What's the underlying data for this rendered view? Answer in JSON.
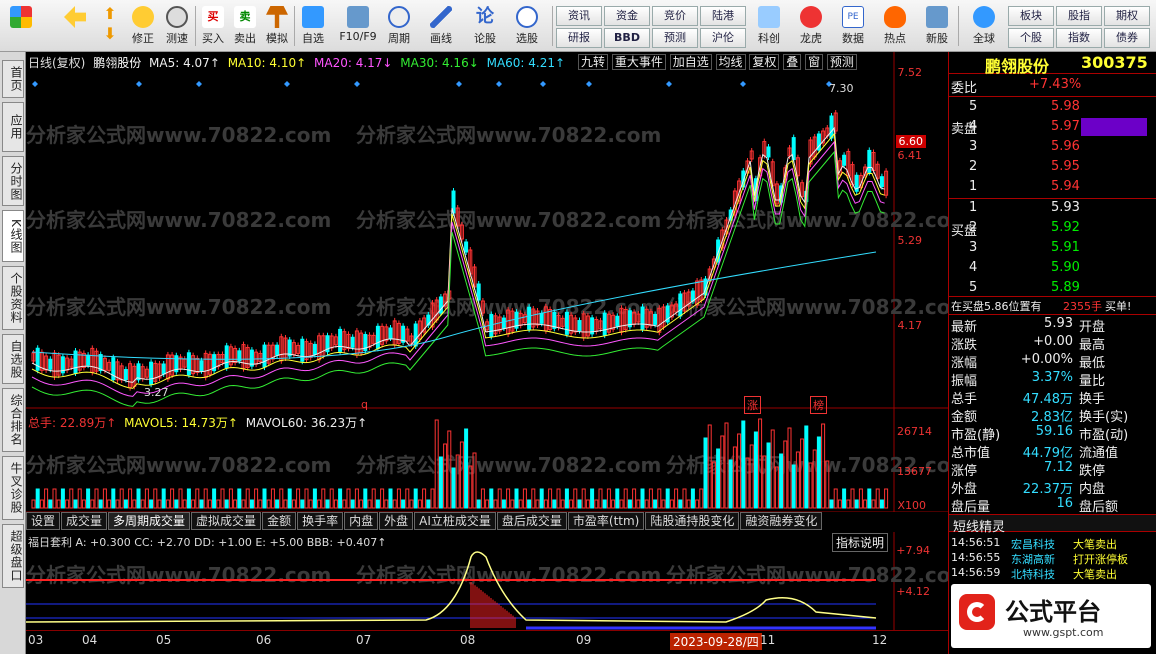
{
  "toolbar": {
    "buttons": [
      "买入",
      "卖出",
      "模拟",
      "自选",
      "F10/F9",
      "周期",
      "画线",
      "论股",
      "选股",
      "科创",
      "龙虎",
      "数据",
      "热点",
      "新股",
      "全球"
    ],
    "nav": [
      "修正",
      "测速"
    ],
    "links": [
      "资讯",
      "资金",
      "竞价",
      "陆港",
      "研报",
      "BBD",
      "预测",
      "沪伦"
    ],
    "right_links": [
      "板块",
      "股指",
      "期权",
      "个股",
      "指数",
      "债券"
    ]
  },
  "left_tabs": [
    "首页",
    "应用",
    "分时图",
    "K线图",
    "个股资料",
    "自选股",
    "综合排名",
    "牛叉诊股",
    "超级盘口"
  ],
  "chart": {
    "header_prefix": "日线(复权)",
    "stock": "鹏翎股份",
    "ma": [
      {
        "label": "MA5: 4.07↑",
        "color": "#eeeeee"
      },
      {
        "label": "MA10: 4.10↑",
        "color": "#ffff33"
      },
      {
        "label": "MA20: 4.17↓",
        "color": "#ff55ff"
      },
      {
        "label": "MA30: 4.16↓",
        "color": "#33ee33"
      },
      {
        "label": "MA60: 4.21↑",
        "color": "#33ddff"
      }
    ],
    "top_buttons": [
      "九转",
      "重大事件",
      "加自选",
      "均线",
      "复权",
      "叠",
      "窗",
      "预测"
    ],
    "price_labels": [
      "7.52",
      "6.60",
      "6.41",
      "5.29",
      "4.17"
    ],
    "high_label": "7.30",
    "low_label": "3.27",
    "markers": [
      "q",
      "涨",
      "榜"
    ],
    "vol_header": {
      "total": "总手: 22.89万↑",
      "mavol5": "MAVOL5: 14.73万↑",
      "mavol60": "MAVOL60: 36.23万↑"
    },
    "vol_labels": [
      "26714",
      "13677",
      "X100"
    ],
    "tabs": [
      "设置",
      "成交量",
      "多周期成交量",
      "虚拟成交量",
      "金额",
      "换手率",
      "内盘",
      "外盘",
      "AI立桩成交量",
      "盘后成交量",
      "市盈率(ttm)",
      "陆股通持股变化",
      "融资融券变化"
    ],
    "ind_header": "福日套利 A: +0.300  CC: +2.70  DD: +1.00  E: +5.00  BBB: +0.407↑",
    "ind_button": "指标说明",
    "ind_labels": [
      "+7.94",
      "+4.12"
    ],
    "dates": [
      "03",
      "04",
      "05",
      "06",
      "07",
      "08",
      "09",
      "11",
      "12"
    ],
    "date_highlight": "2023-09-28/四",
    "watermark": "分析家公式网www.70822.com"
  },
  "panel": {
    "name": "鹏翎股份",
    "code": "300375",
    "webi_label": "委比",
    "webi": "+7.43%",
    "sell_label": "卖盘",
    "buy_label": "买盘",
    "sells": [
      {
        "n": "5",
        "p": "5.98"
      },
      {
        "n": "4",
        "p": "5.97"
      },
      {
        "n": "3",
        "p": "5.96"
      },
      {
        "n": "2",
        "p": "5.95"
      },
      {
        "n": "1",
        "p": "5.94"
      }
    ],
    "buys": [
      {
        "n": "1",
        "p": "5.93"
      },
      {
        "n": "2",
        "p": "5.92"
      },
      {
        "n": "3",
        "p": "5.91"
      },
      {
        "n": "4",
        "p": "5.90"
      },
      {
        "n": "5",
        "p": "5.89"
      }
    ],
    "buy_line": "在买盘5.86位置有",
    "buy_qty": "2355手",
    "buy_tag": "买单!",
    "stats": [
      {
        "l": "最新",
        "v": "5.93",
        "r": "开盘"
      },
      {
        "l": "涨跌",
        "v": "+0.00",
        "r": "最高"
      },
      {
        "l": "涨幅",
        "v": "+0.00%",
        "r": "最低"
      },
      {
        "l": "振幅",
        "v": "3.37%",
        "r": "量比"
      },
      {
        "l": "总手",
        "v": "47.48万",
        "r": "换手"
      },
      {
        "l": "金额",
        "v": "2.83亿",
        "r": "换手(实)"
      },
      {
        "l": "市盈(静)",
        "v": "59.16",
        "r": "市盈(动)"
      },
      {
        "l": "总市值",
        "v": "44.79亿",
        "r": "流通值"
      },
      {
        "l": "涨停",
        "v": "7.12",
        "r": "跌停"
      },
      {
        "l": "外盘",
        "v": "22.37万",
        "r": "内盘"
      },
      {
        "l": "盘后量",
        "v": "16",
        "r": "盘后额"
      }
    ],
    "short_title": "短线精灵",
    "short": [
      {
        "t": "14:56:51",
        "n": "宏昌科技",
        "e": "大笔卖出"
      },
      {
        "t": "14:56:55",
        "n": "东湖高新",
        "e": "打开涨停板"
      },
      {
        "t": "14:56:59",
        "n": "北特科技",
        "e": "大笔卖出"
      }
    ],
    "logo": "公式平台",
    "logo_url": "www.gspt.com"
  }
}
